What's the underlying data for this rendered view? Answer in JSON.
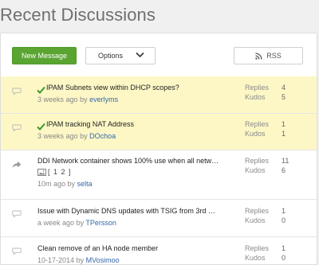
{
  "page": {
    "title": "Recent Discussions"
  },
  "toolbar": {
    "new_message_label": "New Message",
    "options_label": "Options",
    "rss_label": "RSS"
  },
  "labels": {
    "replies": "Replies",
    "kudos": "Kudos",
    "by": "by"
  },
  "colors": {
    "highlight_bg": "#fdf7c6",
    "accent_green": "#5aa532",
    "link_blue": "#3568a8"
  },
  "discussions": [
    {
      "icon": "speech-bubble-icon",
      "solved": true,
      "title": "IPAM Subnets view within DHCP scopes?",
      "time": "3 weeks ago",
      "author": "everlyms",
      "replies": "4",
      "kudos": "5",
      "highlighted": true
    },
    {
      "icon": "speech-bubble-icon",
      "solved": true,
      "title": "IPAM tracking NAT Address",
      "time": "3 weeks ago",
      "author": "DOchoa",
      "replies": "1",
      "kudos": "1",
      "highlighted": true
    },
    {
      "icon": "forward-arrow-icon",
      "solved": false,
      "title": "DDI Network container shows 100% use when all netw…",
      "attachment_pages": "[ 1 2 ]",
      "time": "10m ago",
      "author": "selta",
      "replies": "11",
      "kudos": "6",
      "highlighted": false
    },
    {
      "icon": "speech-bubble-icon",
      "solved": false,
      "title": "Issue with Dynamic DNS updates with TSIG from 3rd …",
      "time": "a week ago",
      "author": "TPersson",
      "replies": "1",
      "kudos": "0",
      "highlighted": false
    },
    {
      "icon": "speech-bubble-icon",
      "solved": false,
      "title": "Clean remove of an HA node member",
      "time": "10-17-2014",
      "author": "MVosimoo",
      "replies": "1",
      "kudos": "0",
      "highlighted": false
    }
  ]
}
